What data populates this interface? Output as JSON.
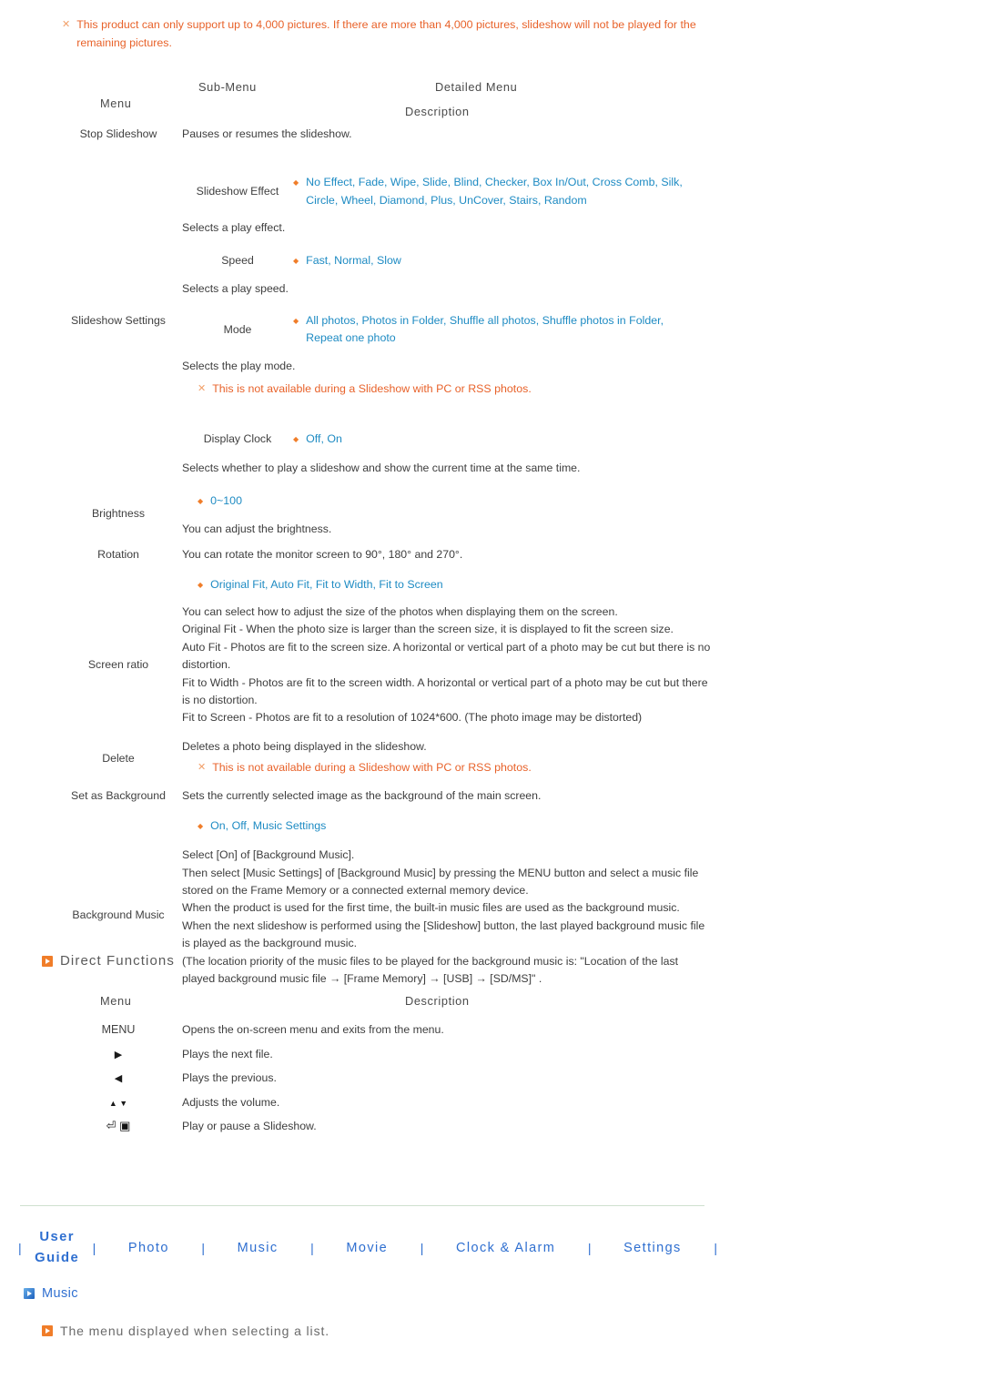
{
  "top_warning": {
    "marker": "✕",
    "text": "This product can only support up to 4,000 pictures. If there are more than 4,000 pictures, slideshow will not be played for the remaining pictures."
  },
  "table_header": {
    "menu": "Menu",
    "sub_menu": "Sub-Menu",
    "detailed_menu": "Detailed Menu",
    "description": "Description"
  },
  "rows": {
    "stop_slideshow": {
      "label": "Stop Slideshow",
      "description": "Pauses or resumes the slideshow."
    },
    "slideshow_settings": {
      "label": "Slideshow Settings",
      "effect": {
        "sub_label": "Slideshow Effect",
        "options": "No Effect, Fade, Wipe, Slide, Blind, Checker, Box In/Out, Cross Comb, Silk, Circle, Wheel, Diamond, Plus, UnCover, Stairs, Random",
        "description": "Selects a play effect."
      },
      "speed": {
        "sub_label": "Speed",
        "options": "Fast, Normal, Slow",
        "description": "Selects a play speed."
      },
      "mode": {
        "sub_label": "Mode",
        "options": "All photos, Photos in Folder, Shuffle all photos, Shuffle photos in Folder, Repeat one photo",
        "description": "Selects the play mode.",
        "note_marker": "✕",
        "note": "This is not available during a Slideshow with PC or RSS photos."
      },
      "display_clock": {
        "sub_label": "Display Clock",
        "options": "Off, On",
        "description": "Selects whether to play a slideshow and show the current time at the same time."
      }
    },
    "brightness": {
      "label": "Brightness",
      "options": "0~100",
      "description": "You can adjust the brightness."
    },
    "rotation": {
      "label": "Rotation",
      "description": "You can rotate the monitor screen to 90°, 180° and 270°."
    },
    "screen_ratio": {
      "label": "Screen ratio",
      "options": "Original Fit, Auto Fit, Fit to Width, Fit to Screen",
      "lines": [
        "You can select how to adjust the size of the photos when displaying them on the screen.",
        "Original Fit - When the photo size is larger than the screen size, it is displayed to fit the screen size.",
        "Auto Fit - Photos are fit to the screen size. A horizontal or vertical part of a photo may be cut but there is no distortion.",
        "Fit to Width - Photos are fit to the screen width. A horizontal or vertical part of a photo may be cut but there is no distortion.",
        "Fit to Screen - Photos are fit to a resolution of 1024*600. (The photo image may be distorted)"
      ]
    },
    "delete": {
      "label": "Delete",
      "description": "Deletes a photo being displayed in the slideshow.",
      "note_marker": "✕",
      "note": "This is not available during a Slideshow with PC or RSS photos."
    },
    "set_as_background": {
      "label": "Set as Background",
      "description": "Sets the currently selected image as the background of the main screen."
    },
    "background_music": {
      "label": "Background Music",
      "options": "On, Off, Music Settings",
      "lines": [
        "Select [On] of [Background Music].",
        "Then select [Music Settings] of [Background Music] by pressing the MENU button and select a music file stored on the Frame Memory or a connected external memory device.",
        "When the product is used for the first time, the built-in music files are used as the background music.",
        "When the next slideshow is performed using the [Slideshow] button, the last played background music file is played as the background music.",
        "(The location priority of the music files to be played for the background music is: \"Location of the last played background music file → [Frame Memory] → [USB] → [SD/MS]\" ."
      ]
    }
  },
  "direct_functions": {
    "heading": "Direct Functions",
    "header": {
      "menu": "Menu",
      "description": "Description"
    },
    "items": [
      {
        "key": "MENU",
        "glyph": "",
        "description": "Opens the on-screen menu and exits from the menu."
      },
      {
        "key": "",
        "glyph": "▶",
        "description": "Plays the next file."
      },
      {
        "key": "",
        "glyph": "◀",
        "description": "Plays the previous."
      },
      {
        "key": "",
        "glyph": "▲ ▼",
        "description": "Adjusts the volume."
      },
      {
        "key": "",
        "glyph": "⏎ ▣",
        "description": "Play or pause a Slideshow."
      }
    ]
  },
  "footer_nav": {
    "separator": "|",
    "items": [
      {
        "label": "User Guide",
        "bold": true
      },
      {
        "label": "Photo",
        "bold": false
      },
      {
        "label": "Music",
        "bold": false
      },
      {
        "label": "Movie",
        "bold": false
      },
      {
        "label": "Clock & Alarm",
        "bold": false
      },
      {
        "label": "Settings",
        "bold": false
      }
    ]
  },
  "music_section": {
    "heading": "Music",
    "subheading": "The menu displayed when selecting a list."
  },
  "colors": {
    "warning": "#e8622a",
    "option_blue": "#1e8bc3",
    "bullet_orange": "#f07d29",
    "nav_blue": "#2f6fd0",
    "text": "#3d3d3d",
    "divider": "#cfe0cf"
  }
}
